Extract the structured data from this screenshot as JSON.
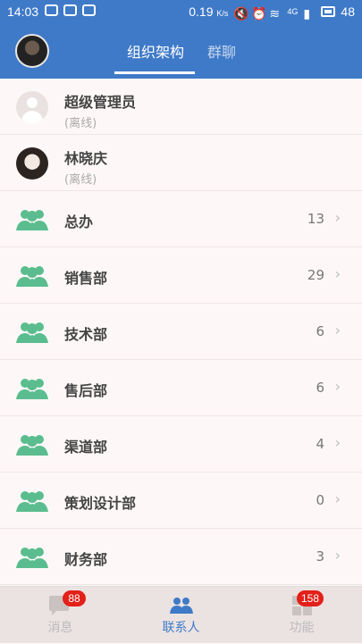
{
  "status_bar": {
    "time": "14:03",
    "speed": "0.19",
    "speed_unit": "K/s",
    "network": "4G",
    "battery": "48"
  },
  "header": {
    "tabs": [
      {
        "label": "组织架构",
        "active": true
      },
      {
        "label": "群聊",
        "active": false
      }
    ]
  },
  "contacts": [
    {
      "name": "超级管理员",
      "status": "(离线)",
      "avatar": "default-user-icon"
    },
    {
      "name": "林晓庆",
      "status": "(离线)",
      "avatar": "user-photo"
    }
  ],
  "departments": [
    {
      "name": "总办",
      "count": "13"
    },
    {
      "name": "销售部",
      "count": "29"
    },
    {
      "name": "技术部",
      "count": "6"
    },
    {
      "name": "售后部",
      "count": "6"
    },
    {
      "name": "渠道部",
      "count": "4"
    },
    {
      "name": "策划设计部",
      "count": "0"
    },
    {
      "name": "财务部",
      "count": "3"
    }
  ],
  "bottom_nav": {
    "items": [
      {
        "label": "消息",
        "icon": "message-icon",
        "badge": "88"
      },
      {
        "label": "联系人",
        "icon": "contacts-icon",
        "badge": ""
      },
      {
        "label": "功能",
        "icon": "apps-icon",
        "badge": "158"
      }
    ]
  },
  "colors": {
    "primary": "#3f7ac8",
    "group_icon": "#5bbd8f",
    "badge": "#e32019"
  }
}
